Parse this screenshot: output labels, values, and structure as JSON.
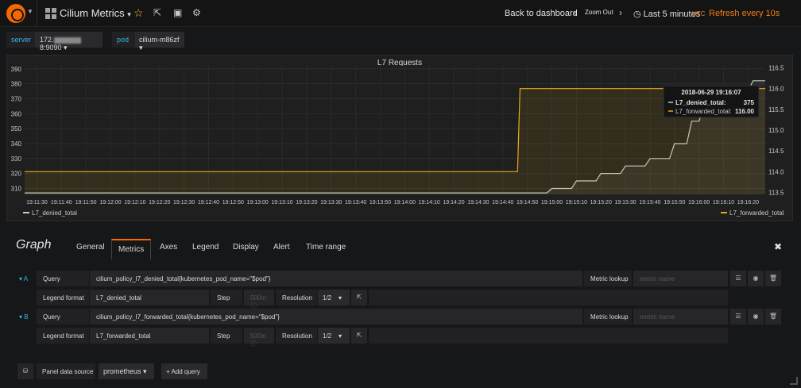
{
  "navbar": {
    "dashboard_title": "Cilium Metrics",
    "title_caret": "▾",
    "back_to_dashboard": "Back to dashboard",
    "zoom_out": "Zoom Out",
    "time_range": "Last 5 minutes",
    "timezone": "UTC",
    "refresh": "Refresh every 10s"
  },
  "variables": [
    {
      "label": "server",
      "value_prefix": "172.",
      "value_suffix": "8:9090"
    },
    {
      "label": "pod",
      "value": "cilium-m86zf"
    }
  ],
  "panel": {
    "title": "L7 Requests",
    "tooltip": {
      "time": "2018-06-29 19:16:07",
      "rows": [
        {
          "name": "L7_denied_total:",
          "value": "375"
        },
        {
          "name": "L7_forwarded_total:",
          "value": "116.00"
        }
      ]
    }
  },
  "chart_data": {
    "type": "line",
    "title": "L7 Requests",
    "x_ticks": [
      "19:11:30",
      "19:11:40",
      "19:11:50",
      "19:12:00",
      "19:12:10",
      "19:12:20",
      "19:12:30",
      "19:12:40",
      "19:12:50",
      "19:13:00",
      "19:13:10",
      "19:13:20",
      "19:13:30",
      "19:13:40",
      "19:13:50",
      "19:14:00",
      "19:14:10",
      "19:14:20",
      "19:14:30",
      "19:14:40",
      "19:14:50",
      "19:15:00",
      "19:15:10",
      "19:15:20",
      "19:15:30",
      "19:15:40",
      "19:15:50",
      "19:16:00",
      "19:16:10",
      "19:16:20"
    ],
    "x_range": [
      "19:11:25",
      "19:16:27"
    ],
    "y_left": {
      "ticks": [
        310,
        320,
        330,
        340,
        350,
        360,
        370,
        380,
        390
      ],
      "range": [
        306,
        392
      ]
    },
    "y_right": {
      "ticks": [
        "113.5",
        "114.0",
        "114.5",
        "115.0",
        "115.5",
        "116.0",
        "116.5"
      ],
      "range": [
        113.45,
        116.55
      ]
    },
    "series": [
      {
        "name": "L7_denied_total",
        "axis": "left",
        "color": "#c9c9c9",
        "points": [
          [
            "19:11:25",
            307
          ],
          [
            "19:14:58",
            307
          ],
          [
            "19:15:00",
            310
          ],
          [
            "19:15:08",
            310
          ],
          [
            "19:15:10",
            315
          ],
          [
            "19:15:18",
            315
          ],
          [
            "19:15:20",
            320
          ],
          [
            "19:15:28",
            320
          ],
          [
            "19:15:30",
            325
          ],
          [
            "19:15:38",
            325
          ],
          [
            "19:15:40",
            330
          ],
          [
            "19:15:48",
            330
          ],
          [
            "19:15:50",
            340
          ],
          [
            "19:15:55",
            340
          ],
          [
            "19:15:57",
            355
          ],
          [
            "19:16:00",
            355
          ],
          [
            "19:16:02",
            365
          ],
          [
            "19:16:05",
            375
          ],
          [
            "19:16:20",
            375
          ],
          [
            "19:16:22",
            382
          ],
          [
            "19:16:27",
            382
          ]
        ]
      },
      {
        "name": "L7_forwarded_total",
        "axis": "right",
        "color": "#e5ac0e",
        "points": [
          [
            "19:11:25",
            114.0
          ],
          [
            "19:14:46",
            114.0
          ],
          [
            "19:14:47",
            116.0
          ],
          [
            "19:16:27",
            116.0
          ]
        ]
      }
    ],
    "legend": [
      {
        "name": "L7_denied_total",
        "placement": "bottom-left"
      },
      {
        "name": "L7_forwarded_total",
        "placement": "bottom-right"
      }
    ],
    "grid": true
  },
  "editor": {
    "heading": "Graph",
    "tabs": [
      "General",
      "Metrics",
      "Axes",
      "Legend",
      "Display",
      "Alert",
      "Time range"
    ],
    "active_tab": "Metrics",
    "queries": [
      {
        "letter": "A",
        "query_label": "Query",
        "query": "cilium_policy_l7_denied_total{kubernetes_pod_name=\"$pod\"}",
        "metric_lookup_label": "Metric lookup",
        "metric_placeholder": "metric name",
        "legend_label": "Legend format",
        "legend": "L7_denied_total",
        "step_label": "Step",
        "step_placeholder": "500m",
        "resolution_label": "Resolution",
        "resolution": "1/2"
      },
      {
        "letter": "B",
        "query_label": "Query",
        "query": "cilium_policy_l7_forwarded_total{kubernetes_pod_name=\"$pod\"}",
        "metric_lookup_label": "Metric lookup",
        "metric_placeholder": "metric name",
        "legend_label": "Legend format",
        "legend": "L7_forwarded_total",
        "step_label": "Step",
        "step_placeholder": "500m",
        "resolution_label": "Resolution",
        "resolution": "1/2"
      }
    ],
    "datasource_label": "Panel data source",
    "datasource": "prometheus",
    "add_query": "Add query"
  },
  "icons": {
    "logo": "grafana-logo-icon",
    "dashboard": "dashboard-grid-icon",
    "star": "star-icon",
    "share": "share-icon",
    "save": "save-icon",
    "settings": "gear-icon",
    "clock": "clock-icon",
    "close": "close-icon",
    "menu": "hamburger-icon",
    "eye": "eye-icon",
    "trash": "trash-icon",
    "database": "database-icon",
    "external": "external-link-icon",
    "info": "info-icon"
  },
  "colors": {
    "accent_orange": "#eb7b18",
    "variable_blue": "#33b5e5",
    "forwarded_series": "#e5ac0e",
    "denied_series": "#c9c9c9"
  }
}
